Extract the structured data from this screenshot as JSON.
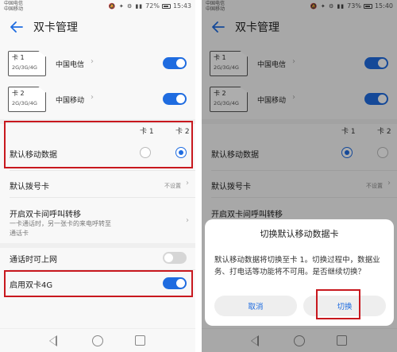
{
  "colors": {
    "accent": "#1f6ce0",
    "highlight_box": "#c8181e",
    "toggle_off": "#d6d6d6"
  },
  "left": {
    "status": {
      "carrier_line1": "中国电信",
      "carrier_line2": "中国移动",
      "icons": "🔕 ✦ ⚙ ▮▮",
      "battery": "72%",
      "time": "15:43"
    },
    "title": "双卡管理",
    "sims": [
      {
        "name": "卡 1",
        "network": "2G/3G/4G",
        "carrier": "中国电信",
        "enabled": true
      },
      {
        "name": "卡 2",
        "network": "2G/3G/4G",
        "carrier": "中国移动",
        "enabled": true
      }
    ],
    "columns": {
      "card1": "卡 1",
      "card2": "卡 2"
    },
    "default_data": {
      "label": "默认移动数据",
      "selected": "卡 2"
    },
    "default_dial": {
      "label": "默认拨号卡",
      "value": "不设置"
    },
    "call_forward": {
      "label": "开启双卡间呼叫转移",
      "desc_line1": "一卡通话时，另一张卡的来电呼转至",
      "desc_line2": "通话卡"
    },
    "data_during_call": {
      "label": "通话时可上网",
      "enabled": false
    },
    "enable_4g": {
      "label": "启用双卡4G",
      "enabled": true
    }
  },
  "right": {
    "status": {
      "carrier_line1": "中国电信",
      "carrier_line2": "中国移动",
      "icons": "🔕 ✦ ⚙ ▮▮",
      "battery": "73%",
      "time": "15:40"
    },
    "title": "双卡管理",
    "sims": [
      {
        "name": "卡 1",
        "network": "2G/3G/4G",
        "carrier": "中国电信",
        "enabled": true
      },
      {
        "name": "卡 2",
        "network": "2G/3G/4G",
        "carrier": "中国移动",
        "enabled": true
      }
    ],
    "columns": {
      "card1": "卡 1",
      "card2": "卡 2"
    },
    "default_data": {
      "label": "默认移动数据",
      "selected": "卡 1"
    },
    "default_dial": {
      "label": "默认拨号卡",
      "value": "不设置"
    },
    "call_forward": {
      "label": "开启双卡间呼叫转移"
    },
    "dialog": {
      "title": "切换默认移动数据卡",
      "body": "默认移动数据将切换至卡 1。切换过程中，数据业务、打电话等功能将不可用。是否继续切换？",
      "cancel": "取消",
      "confirm": "切换"
    }
  }
}
